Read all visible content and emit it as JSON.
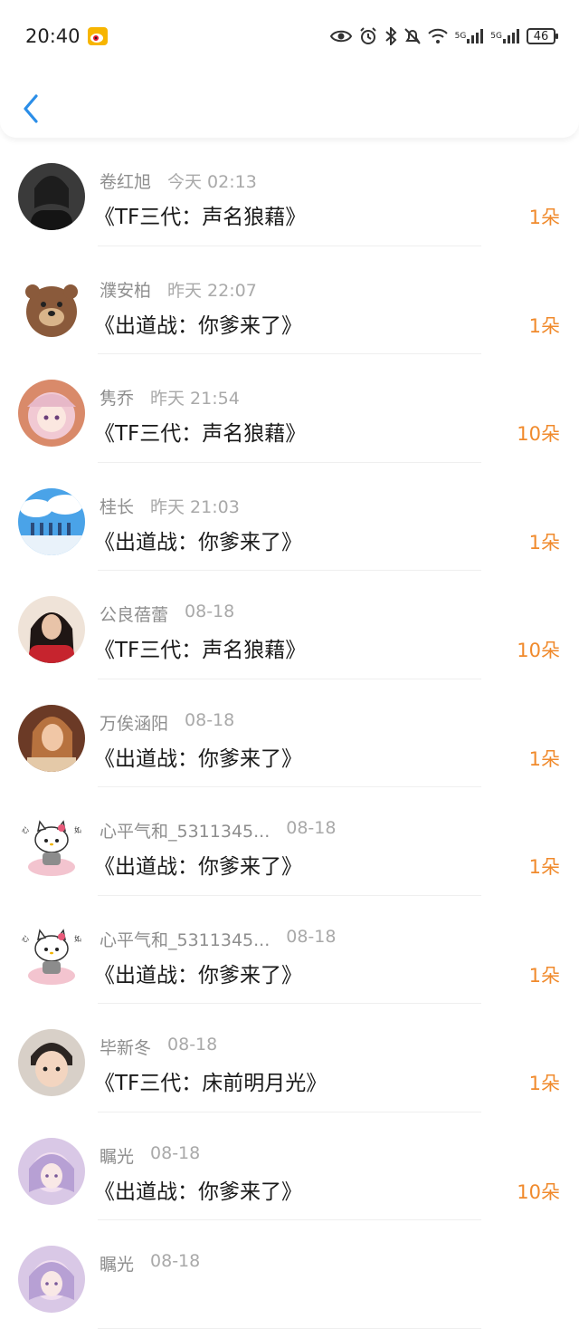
{
  "status_bar": {
    "time": "20:40",
    "network_label_1": "5G",
    "network_label_2": "5G",
    "battery": "46"
  },
  "colors": {
    "accent_blue": "#2b8ee8",
    "count_orange": "#f08a2c"
  },
  "items": [
    {
      "name": "卷红旭",
      "time": "今天 02:13",
      "title": "《TF三代：声名狼藉》",
      "count": "1朵",
      "avatar": "avatar-photo-woman"
    },
    {
      "name": "濮安柏",
      "time": "昨天 22:07",
      "title": "《出道战：你爹来了》",
      "count": "1朵",
      "avatar": "avatar-bear"
    },
    {
      "name": "隽乔",
      "time": "昨天 21:54",
      "title": "《TF三代：声名狼藉》",
      "count": "10朵",
      "avatar": "avatar-anime-girl"
    },
    {
      "name": "桂长",
      "time": "昨天 21:03",
      "title": "《出道战：你爹来了》",
      "count": "1朵",
      "avatar": "avatar-sky-group"
    },
    {
      "name": "公良蓓蕾",
      "time": "08-18",
      "title": "《TF三代：声名狼藉》",
      "count": "10朵",
      "avatar": "avatar-photo-red"
    },
    {
      "name": "万俟涵阳",
      "time": "08-18",
      "title": "《出道战：你爹来了》",
      "count": "1朵",
      "avatar": "avatar-photo-warm"
    },
    {
      "name": "心平气和_5311345...",
      "time": "08-18",
      "title": "《出道战：你爹来了》",
      "count": "1朵",
      "avatar": "avatar-hello-kitty"
    },
    {
      "name": "心平气和_5311345...",
      "time": "08-18",
      "title": "《出道战：你爹来了》",
      "count": "1朵",
      "avatar": "avatar-hello-kitty"
    },
    {
      "name": "毕新冬",
      "time": "08-18",
      "title": "《TF三代：床前明月光》",
      "count": "1朵",
      "avatar": "avatar-child"
    },
    {
      "name": "瞩光",
      "time": "08-18",
      "title": "《出道战：你爹来了》",
      "count": "10朵",
      "avatar": "avatar-purple-girl"
    },
    {
      "name": "瞩光",
      "time": "08-18",
      "title": "",
      "count": "",
      "avatar": "avatar-purple-girl"
    }
  ]
}
